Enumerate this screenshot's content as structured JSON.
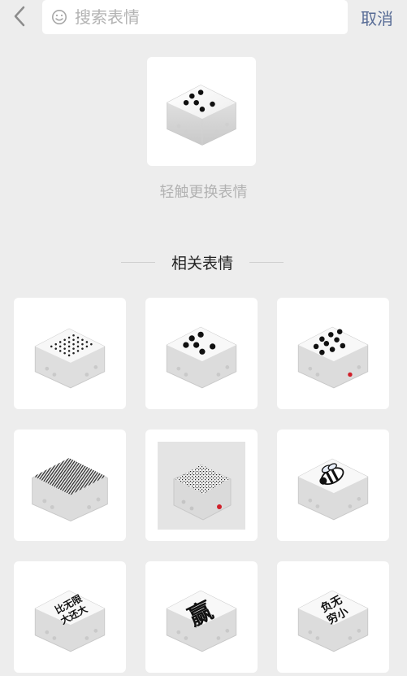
{
  "search": {
    "placeholder": "搜索表情",
    "cancel_label": "取消"
  },
  "preview": {
    "hint": "轻触更换表情"
  },
  "related": {
    "title": "相关表情",
    "items": [
      {
        "face": "many-dots"
      },
      {
        "face": "six"
      },
      {
        "face": "nine"
      },
      {
        "face": "striped"
      },
      {
        "face": "noise"
      },
      {
        "face": "bee"
      },
      {
        "face": "text",
        "text": "比无限大还大"
      },
      {
        "face": "text",
        "text": "赢"
      },
      {
        "face": "text",
        "text": "负无穷小"
      }
    ]
  },
  "colors": {
    "background": "#ededed",
    "accent": "#576b95",
    "pip": "#111111",
    "red_pip": "#d0202a"
  }
}
